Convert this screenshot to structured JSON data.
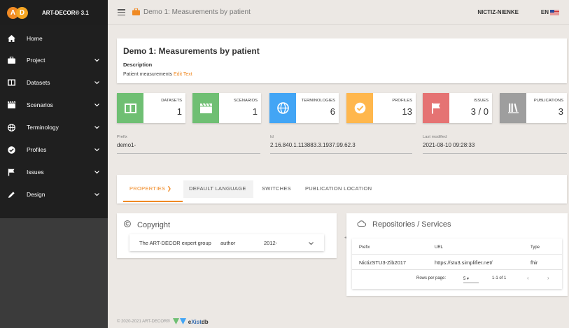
{
  "app": {
    "brand_title": "ART-DECOR® 3.1",
    "logo_letters": [
      "A",
      "D"
    ],
    "colors": {
      "accent": "#f08a24",
      "sidebar_bg": "#1f1f1f",
      "green": "#6fbf73",
      "blue": "#42a5f5",
      "orange": "#ffb74d",
      "red": "#e57373",
      "gray": "#9e9e9e"
    }
  },
  "sidebar": {
    "items": [
      {
        "label": "Home",
        "icon": "home-icon",
        "expandable": false
      },
      {
        "label": "Project",
        "icon": "briefcase-icon",
        "expandable": true
      },
      {
        "label": "Datasets",
        "icon": "book-icon",
        "expandable": true
      },
      {
        "label": "Scenarios",
        "icon": "clapperboard-icon",
        "expandable": true
      },
      {
        "label": "Terminology",
        "icon": "globe-icon",
        "expandable": true
      },
      {
        "label": "Profiles",
        "icon": "check-circle-icon",
        "expandable": true
      },
      {
        "label": "Issues",
        "icon": "flag-icon",
        "expandable": true
      },
      {
        "label": "Design",
        "icon": "pencil-icon",
        "expandable": true
      }
    ]
  },
  "topbar": {
    "title": "Demo 1: Measurements by patient",
    "user": "NICTIZ-NIENKE",
    "language": "EN"
  },
  "header": {
    "title": "Demo 1: Measurements by patient",
    "description_label": "Description",
    "description_text": "Patient measurements",
    "edit_label": "Edit Text"
  },
  "tiles": [
    {
      "label": "DATASETS",
      "value": "1",
      "icon": "book-icon"
    },
    {
      "label": "SCENARIOS",
      "value": "1",
      "icon": "clapperboard-icon"
    },
    {
      "label": "TERMINOLOGIES",
      "value": "6",
      "icon": "globe-icon"
    },
    {
      "label": "PROFILES",
      "value": "13",
      "icon": "check-circle-icon"
    },
    {
      "label": "ISSUES",
      "value": "3 / 0",
      "icon": "flag-icon"
    },
    {
      "label": "PUBLICATIONS",
      "value": "3",
      "icon": "library-icon"
    }
  ],
  "fields": {
    "prefix": {
      "label": "Prefix",
      "value": "demo1-"
    },
    "id": {
      "label": "Id",
      "value": "2.16.840.1.113883.3.1937.99.62.3"
    },
    "modified": {
      "label": "Last modified",
      "value": "2021-08-10 09:28:33"
    }
  },
  "tabs": [
    {
      "label": "PROPERTIES",
      "active": true
    },
    {
      "label": "DEFAULT LANGUAGE",
      "active": false
    },
    {
      "label": "SWITCHES",
      "active": false
    },
    {
      "label": "PUBLICATION LOCATION",
      "active": false
    }
  ],
  "copyright": {
    "title": "Copyright",
    "holder": "The ART-DECOR expert group",
    "role": "author",
    "years": "2012-"
  },
  "repositories": {
    "title": "Repositories / Services",
    "columns": [
      "Prefix",
      "URL",
      "Type"
    ],
    "rows": [
      {
        "prefix": "NictizSTU3-Zib2017",
        "url": "https://stu3.simplifier.net/",
        "type": "fhir"
      }
    ],
    "rows_per_page_label": "Rows per page:",
    "rows_per_page_value": "5",
    "range": "1-1 of 1"
  },
  "footer": {
    "copyright": "© 2020-2021 ART-DECOR®",
    "exist_prefix": "e",
    "exist_text": "Xist",
    "exist_suffix": "db"
  }
}
